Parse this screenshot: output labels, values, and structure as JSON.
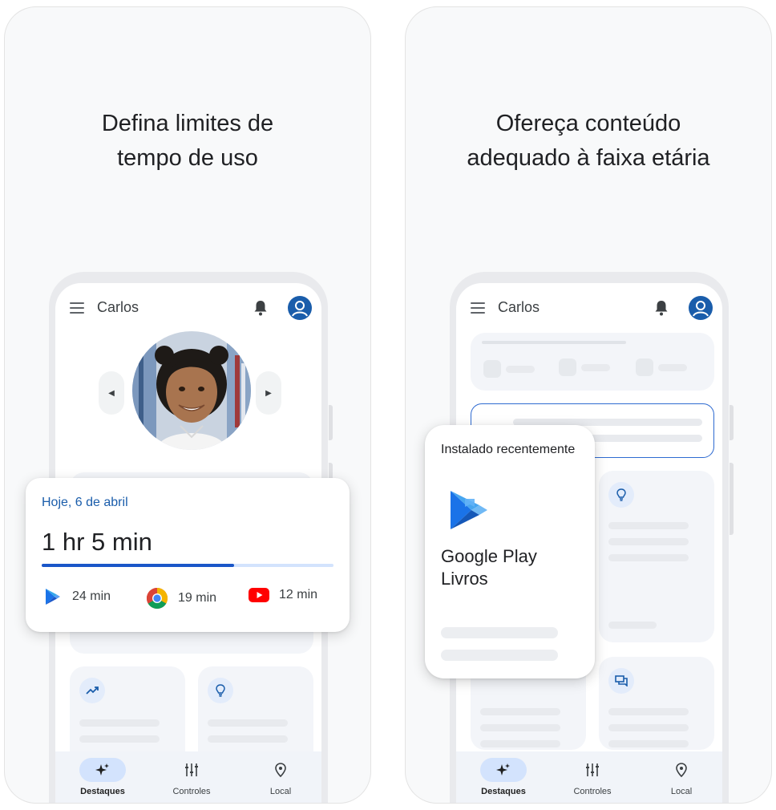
{
  "panels": [
    {
      "headline": [
        "Defina limites de",
        "tempo de uso"
      ],
      "app_title": "Carlos"
    },
    {
      "headline": [
        "Ofereça conteúdo",
        "adequado à faixa etária"
      ],
      "app_title": "Carlos"
    }
  ],
  "bottom_nav": [
    "Destaques",
    "Controles",
    "Local"
  ],
  "usage_card": {
    "date": "Hoje, 6 de abril",
    "total": "1 hr 5 min",
    "progress_fraction": 0.66,
    "apps": [
      {
        "name": "Google Play",
        "icon": "play-icon",
        "time": "24 min"
      },
      {
        "name": "Chrome",
        "icon": "chrome-icon",
        "time": "19 min"
      },
      {
        "name": "YouTube",
        "icon": "youtube-icon",
        "time": "12 min"
      }
    ]
  },
  "installed_card": {
    "label": "Instalado recentemente",
    "app_name": "Google Play Livros",
    "icon": "play-books-icon"
  },
  "colors": {
    "accent_blue": "#1a5dab",
    "progress_blue": "#1a56c8",
    "active_nav_bg": "#d3e3fd",
    "youtube_red": "#ff0000"
  }
}
